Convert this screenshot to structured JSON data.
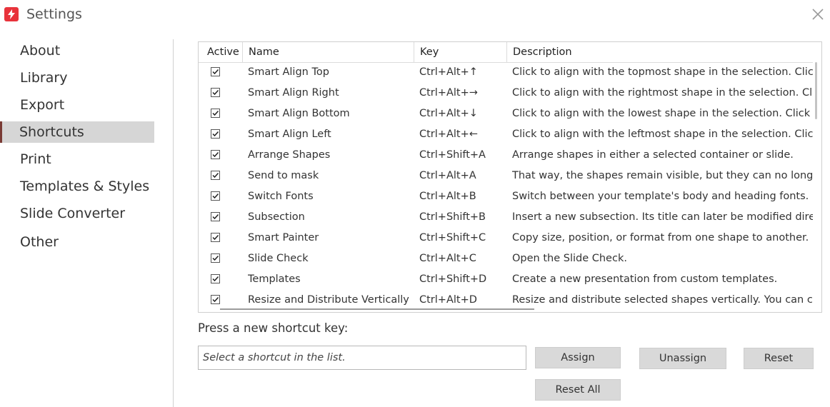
{
  "window": {
    "title": "Settings",
    "accent": "#e8333b",
    "app_icon": "pdf-lightning-icon",
    "close_icon": "close-icon"
  },
  "nav": {
    "items": [
      {
        "label": "About"
      },
      {
        "label": "Library"
      },
      {
        "label": "Export"
      },
      {
        "label": "Shortcuts",
        "active": true
      },
      {
        "label": "Print"
      },
      {
        "label": "Templates & Styles"
      },
      {
        "label": "Slide Converter"
      },
      {
        "label": "Other"
      }
    ]
  },
  "table": {
    "columns": [
      "Active",
      "Name",
      "Key",
      "Description"
    ],
    "rows": [
      {
        "active": true,
        "name": "Smart Align Top",
        "key": "Ctrl+Alt+↑",
        "description": "Click to align with the topmost shape in the selection. Click agai"
      },
      {
        "active": true,
        "name": "Smart Align Right",
        "key": "Ctrl+Alt+→",
        "description": "Click to align with the rightmost shape in the selection. Click aga"
      },
      {
        "active": true,
        "name": "Smart Align Bottom",
        "key": "Ctrl+Alt+↓",
        "description": "Click to align with the lowest shape in the selection. Click again"
      },
      {
        "active": true,
        "name": "Smart Align Left",
        "key": "Ctrl+Alt+←",
        "description": "Click to align with the leftmost shape in the selection. Click agai"
      },
      {
        "active": true,
        "name": "Arrange Shapes",
        "key": "Ctrl+Shift+A",
        "description": "Arrange shapes in either a selected container or slide."
      },
      {
        "active": true,
        "name": "Send to mask",
        "key": "Ctrl+Alt+A",
        "description": "That way, the shapes remain visible, but they can no longer be n"
      },
      {
        "active": true,
        "name": "Switch Fonts",
        "key": "Ctrl+Alt+B",
        "description": "Switch between your template's body and heading fonts."
      },
      {
        "active": true,
        "name": "Subsection",
        "key": "Ctrl+Shift+B",
        "description": "Insert a new subsection. Its title can later be modified directly in"
      },
      {
        "active": true,
        "name": "Smart Painter",
        "key": "Ctrl+Shift+C",
        "description": "Copy size, position, or format from one shape to another."
      },
      {
        "active": true,
        "name": "Slide Check",
        "key": "Ctrl+Alt+C",
        "description": "Open the Slide Check."
      },
      {
        "active": true,
        "name": "Templates",
        "key": "Ctrl+Shift+D",
        "description": "Create a new presentation from custom templates."
      },
      {
        "active": true,
        "name": "Resize and Distribute Vertically",
        "key": "Ctrl+Alt+D",
        "description": "Resize and distribute selected shapes vertically. You can custom"
      }
    ]
  },
  "shortcut": {
    "prompt": "Press a new shortcut key:",
    "placeholder": "Select a shortcut in the list.",
    "assign_label": "Assign",
    "unassign_label": "Unassign",
    "reset_label": "Reset",
    "reset_all_label": "Reset All"
  }
}
